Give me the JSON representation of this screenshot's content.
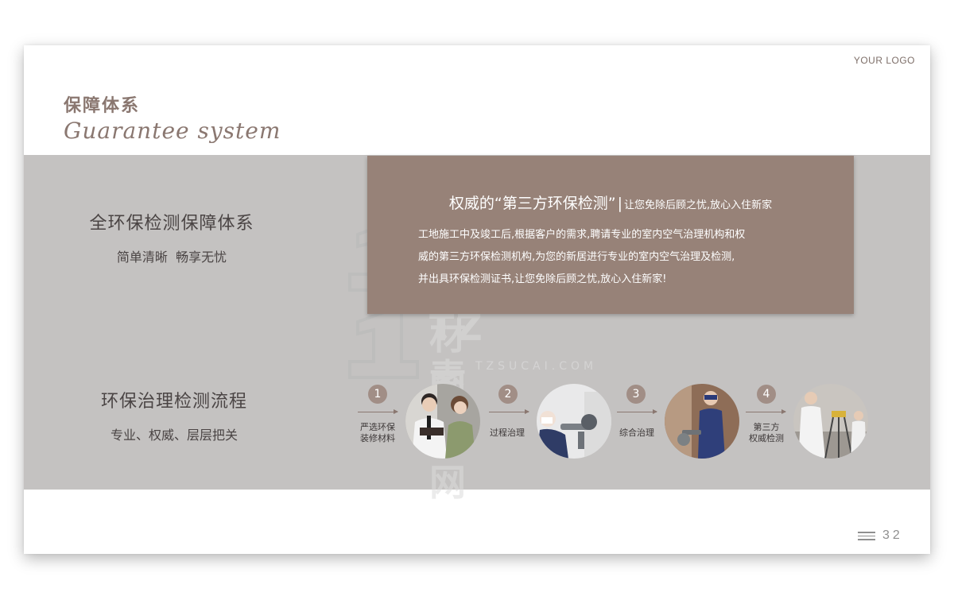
{
  "header": {
    "logo": "YOUR LOGO",
    "title_cn": "保障体系",
    "title_en": "Guarantee system"
  },
  "info_box": {
    "heading_main": "权威的“第三方环保检测”",
    "heading_sub": "让您免除后顾之忧,放心入住新家",
    "body_lines": [
      "工地施工中及竣工后,根据客户的需求,聘请专业的室内空气治理机构和权",
      "威的第三方环保检测机构,为您的新居进行专业的室内空气治理及检测,",
      "并出具环保检测证书,让您免除后顾之忧,放心入住新家!"
    ]
  },
  "section1": {
    "heading": "全环保检测保障体系",
    "subtitle": "简单清晰  畅享无忧"
  },
  "section2": {
    "heading": "环保治理检测流程",
    "subtitle": "专业、权威、层层把关"
  },
  "steps": [
    {
      "number": "1",
      "label_lines": [
        "严选环保",
        "装修材料"
      ]
    },
    {
      "number": "2",
      "label_lines": [
        "过程治理"
      ]
    },
    {
      "number": "3",
      "label_lines": [
        "综合治理"
      ]
    },
    {
      "number": "4",
      "label_lines": [
        "第三方",
        "权威检测"
      ]
    }
  ],
  "watermark": {
    "brand": "TZ素材网",
    "url": "TZSUCAI.COM"
  },
  "footer": {
    "page_number": "32",
    "menu_icon": "hamburger-menu-icon"
  },
  "colors": {
    "accent": "#978278",
    "band": "#c4c2c1",
    "title": "#8a7770"
  }
}
